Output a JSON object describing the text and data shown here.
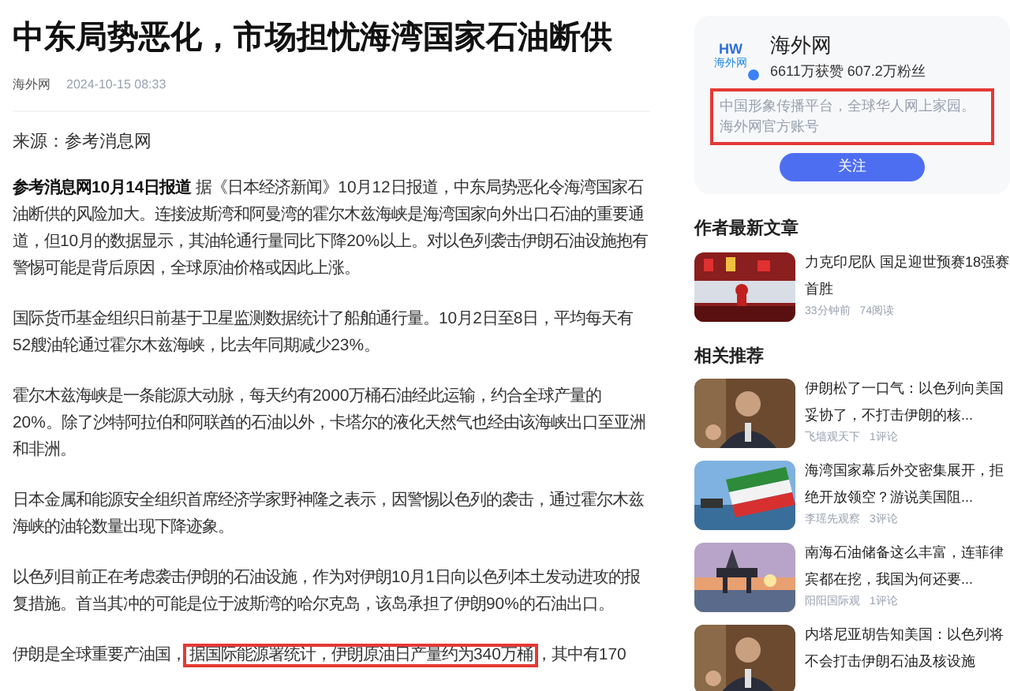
{
  "article": {
    "title": "中东局势恶化，市场担忧海湾国家石油断供",
    "source": "海外网",
    "date": "2024-10-15 08:33",
    "origin": "来源：参考消息网",
    "paragraphs": [
      [
        {
          "text": "参考消息网10月14日报道",
          "bold": true,
          "highlighted": false
        },
        {
          "text": " 据《日本经济新闻》10月12日报道，中东局势恶化令海湾国家石油断供的风险加大。连接波斯湾和阿曼湾的霍尔木兹海峡是海湾国家向外出口石油的重要通道，但10月的数据显示，其油轮通行量同比下降20%以上。对以色列袭击伊朗石油设施抱有警惕可能是背后原因，全球原油价格或因此上涨。",
          "bold": false,
          "highlighted": false
        }
      ],
      [
        {
          "text": "国际货币基金组织日前基于卫星监测数据统计了船舶通行量。10月2日至8日，平均每天有52艘油轮通过霍尔木兹海峡，比去年同期减少23%。",
          "bold": false,
          "highlighted": false
        }
      ],
      [
        {
          "text": "霍尔木兹海峡是一条能源大动脉，每天约有2000万桶石油经此运输，约合全球产量的20%。除了沙特阿拉伯和阿联酋的石油以外，卡塔尔的液化天然气也经由该海峡出口至亚洲和非洲。",
          "bold": false,
          "highlighted": false
        }
      ],
      [
        {
          "text": "日本金属和能源安全组织首席经济学家野神隆之表示，因警惕以色列的袭击，通过霍尔木兹海峡的油轮数量出现下降迹象。",
          "bold": false,
          "highlighted": false
        }
      ],
      [
        {
          "text": "以色列目前正在考虑袭击伊朗的石油设施，作为对伊朗10月1日向以色列本土发动进攻的报复措施。首当其冲的可能是位于波斯湾的哈尔克岛，该岛承担了伊朗90%的石油出口。",
          "bold": false,
          "highlighted": false
        }
      ],
      [
        {
          "text": "伊朗是全球重要产油国，",
          "bold": false,
          "highlighted": false
        },
        {
          "text": "据国际能源署统计，伊朗原油日产量约为340万桶",
          "bold": false,
          "highlighted": true
        },
        {
          "text": "，其中有170",
          "bold": false,
          "highlighted": false
        }
      ]
    ]
  },
  "author_card": {
    "logo_top": "HW",
    "logo_bottom": "海外网",
    "verified": true,
    "name": "海外网",
    "stats": "6611万获赞 607.2万粉丝",
    "bio": "中国形象传播平台，全球华人网上家园。海外网官方账号",
    "bio_highlighted": true,
    "follow_button": "关注"
  },
  "author_latest": {
    "heading": "作者最新文章",
    "items": [
      {
        "title": "力克印尼队 国足迎世预赛18强赛首胜",
        "meta": [
          "33分钟前",
          "74阅读"
        ],
        "thumbnail": {
          "kind": "picture"
        }
      }
    ]
  },
  "related": {
    "heading": "相关推荐",
    "items": [
      {
        "title": "伊朗松了一口气：以色列向美国妥协了，不打击伊朗的核...",
        "meta": [
          "飞墙观天下",
          "1评论"
        ],
        "thumbnail": {
          "kind": "picture"
        }
      },
      {
        "title": "海湾国家幕后外交密集展开，拒绝开放领空？游说美国阻...",
        "meta": [
          "李瑶先观察",
          "3评论"
        ],
        "thumbnail": {
          "kind": "picture"
        }
      },
      {
        "title": "南海石油储备这么丰富，连菲律宾都在挖，我国为何还要...",
        "meta": [
          "阳阳国际观",
          "1评论"
        ],
        "thumbnail": {
          "kind": "picture"
        }
      },
      {
        "title": "内塔尼亚胡告知美国：以色列将不会打击伊朗石油及核设施",
        "thumbnail": {
          "kind": "picture"
        }
      }
    ]
  }
}
